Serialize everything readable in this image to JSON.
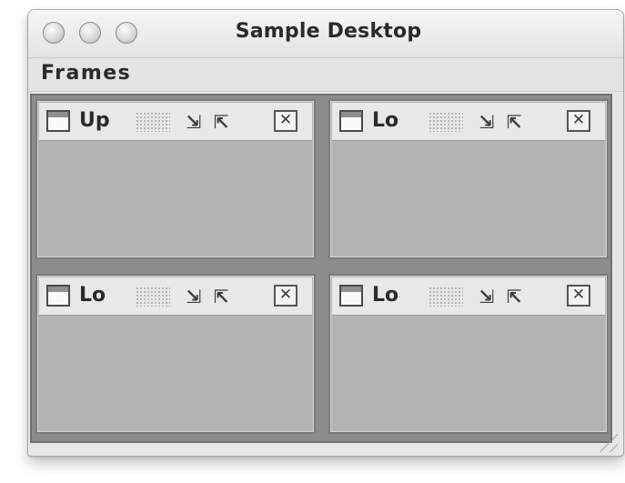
{
  "window": {
    "title": "Sample Desktop"
  },
  "menubar": {
    "items": [
      {
        "label": "Frames"
      }
    ]
  },
  "frames": [
    {
      "title": "Up",
      "iconify_glyph": "⇲",
      "maximize_glyph": "⇱",
      "close_glyph": "✕"
    },
    {
      "title": "Lo",
      "iconify_glyph": "⇲",
      "maximize_glyph": "⇱",
      "close_glyph": "✕"
    },
    {
      "title": "Lo",
      "iconify_glyph": "⇲",
      "maximize_glyph": "⇱",
      "close_glyph": "✕"
    },
    {
      "title": "Lo",
      "iconify_glyph": "⇲",
      "maximize_glyph": "⇱",
      "close_glyph": "✕"
    }
  ],
  "icons": {
    "traffic_close": "close-traffic-icon",
    "traffic_minimize": "minimize-traffic-icon",
    "traffic_zoom": "zoom-traffic-icon",
    "frame": "frame-icon",
    "iconify": "iconify-icon",
    "maximize": "maximize-icon",
    "close": "close-icon",
    "resize": "resize-grip-icon"
  },
  "colors": {
    "desktop": "#8c8c8c",
    "frame_body": "#b3b3b3",
    "title_bar": "#e8e8e8"
  }
}
